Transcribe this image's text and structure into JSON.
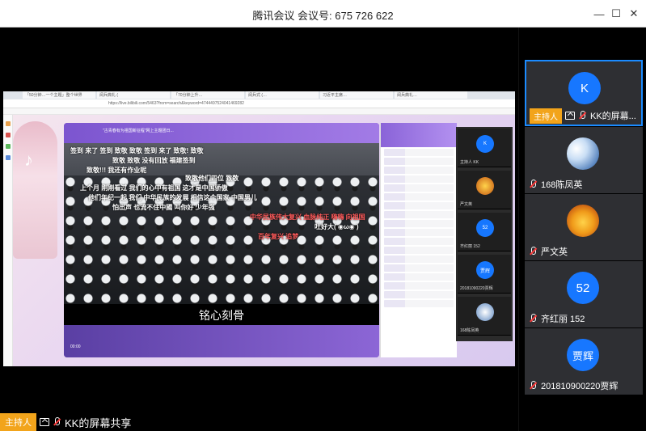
{
  "window": {
    "title": "腾讯会议  会议号: 675 726 622",
    "minimize_label": "—",
    "maximize_label": "☐",
    "close_label": "✕"
  },
  "shared_screen": {
    "browser_tabs": [
      "「50分钟…一个主题」整个世界",
      "阅兵典礼 (  ",
      "「70分钟上升…  ",
      "阅兵式 (…",
      "习近平主席…",
      "阅兵典礼…",
      "青春有为…"
    ],
    "address": "https://live.bilibili.com/5463?from=search&keyword=4744497524041469282",
    "stream_title": "\"古青春有为祖国新征程\"网上主题团日...",
    "danmu": [
      {
        "text": "签到  来了  签到  致敬  致敬  签到  来了  致敬!  致敬",
        "red": false
      },
      {
        "text": "致敬      致敬      没有回放      福建签到",
        "red": false
      },
      {
        "text": "致敬!!!  我还有作业呢",
        "red": false
      },
      {
        "text": "致敬他们四位  致敬",
        "red": false
      },
      {
        "text": "上个月 刚刚看过  我们的心中有祖国  这才是中国骄傲",
        "red": false
      },
      {
        "text": "他们年纪一起 我们  中华民族的发展  相信这个国家  中国男儿",
        "red": false
      },
      {
        "text": "怕出声  也流不住中國  叫你好  少年强",
        "red": false
      },
      {
        "text": "中华民族伟大复兴  血脉纯正  嗨嗨  向祖国",
        "red": true
      },
      {
        "text": "吐好大(  ◉ω◉  )",
        "red": false
      },
      {
        "text": "百年复兴 追梦",
        "red": true
      }
    ],
    "subtitle": "铭心刻骨",
    "stream_footer_time": "00:00",
    "mini_gallery": [
      {
        "initial": "K",
        "name": "主持人  KK"
      },
      {
        "initial": "",
        "name": "严文英"
      },
      {
        "initial": "52",
        "name": "齐红丽 152"
      },
      {
        "initial": "贾辉",
        "name": "20181090220贾辉"
      },
      {
        "initial": "",
        "name": "168陈凤英"
      }
    ]
  },
  "participants": [
    {
      "initial": "K",
      "avatar_style": "blue",
      "name": "KK的屏幕...",
      "host": true,
      "host_label": "主持人",
      "active": true
    },
    {
      "initial": "",
      "avatar_style": "sky",
      "name": "168陈凤英",
      "host": false,
      "active": false
    },
    {
      "initial": "",
      "avatar_style": "maple",
      "name": "严文英",
      "host": false,
      "active": false
    },
    {
      "initial": "52",
      "avatar_style": "blue",
      "name": "齐红丽 152",
      "host": false,
      "active": false
    },
    {
      "initial": "贾辉",
      "avatar_style": "blue",
      "name": "201810900220贾辉",
      "host": false,
      "active": false
    }
  ],
  "share_status": {
    "host_label": "主持人",
    "text": "KK的屏幕共享"
  },
  "colors": {
    "accent": "#1777ff",
    "host_badge": "#f2a41b",
    "muted_mic": "#ff3b3b"
  }
}
